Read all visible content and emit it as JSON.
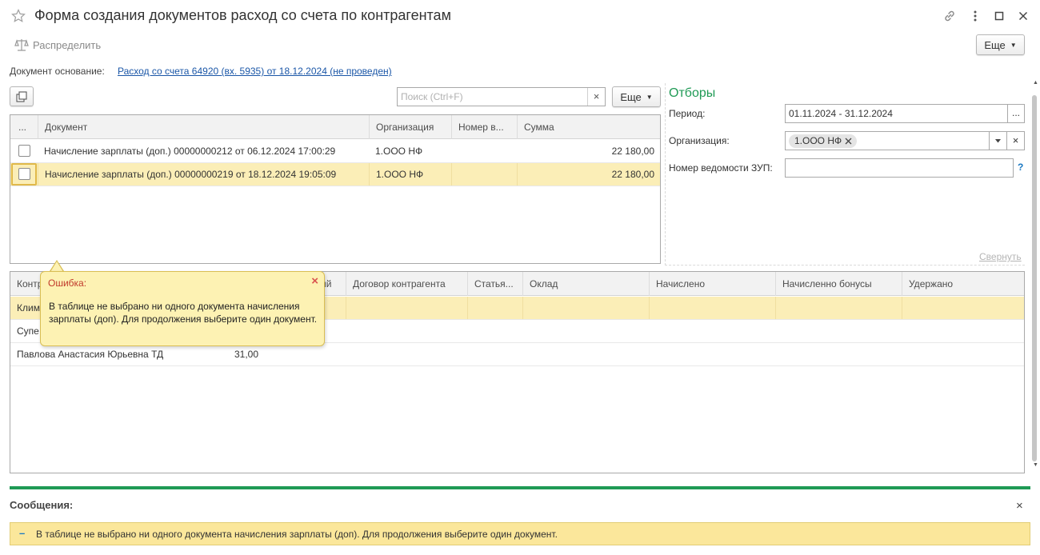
{
  "window": {
    "title": "Форма создания документов расход со счета по контрагентам"
  },
  "toolbar": {
    "distribute_label": "Распределить",
    "more_label": "Еще"
  },
  "basis": {
    "label": "Документ основание:",
    "link": "Расход со счета 64920 (вх. 5935) от 18.12.2024 (не проведен)"
  },
  "docs_panel": {
    "search_placeholder": "Поиск (Ctrl+F)",
    "search_clear": "×",
    "more_label": "Еще",
    "columns": [
      "...",
      "Документ",
      "Организация",
      "Номер в...",
      "Сумма"
    ],
    "rows": [
      {
        "checked": false,
        "document": "Начисление зарплаты (доп.) 00000000212 от 06.12.2024 17:00:29",
        "org": "1.ООО НФ",
        "number": "",
        "sum": "22 180,00"
      },
      {
        "checked": false,
        "document": "Начисление зарплаты (доп.) 00000000219 от 18.12.2024 19:05:09",
        "org": "1.ООО НФ",
        "number": "",
        "sum": "22 180,00"
      }
    ]
  },
  "filters": {
    "title": "Отборы",
    "period_label": "Период:",
    "period_value": "01.11.2024 - 31.12.2024",
    "period_btn": "...",
    "org_label": "Организация:",
    "org_tag": "1.ООО НФ",
    "org_clear": "×",
    "zup_label": "Номер ведомости ЗУП:",
    "zup_value": "",
    "help": "?",
    "collapse_link": "Свернуть"
  },
  "bottom_table": {
    "columns": [
      "Контр",
      "ий",
      "Договор контрагента",
      "Статья...",
      "Оклад",
      "Начислено",
      "Начисленно бонусы",
      "Удержано"
    ],
    "rows": [
      {
        "name": "Клим",
        "amount": ""
      },
      {
        "name": "Супе",
        "amount": ""
      },
      {
        "name": "Павлова Анастасия Юрьевна ТД",
        "amount": "31,00"
      }
    ]
  },
  "tooltip": {
    "title": "Ошибка:",
    "close": "×",
    "text": "В таблице не выбрано ни одного документа начисления зарплаты (доп). Для продолжения выберите один документ."
  },
  "messages": {
    "title": "Сообщения:",
    "close": "×",
    "bullet": "–",
    "text": "В таблице не выбрано ни одного документа начисления зарплаты (доп). Для продолжения выберите один документ."
  },
  "colors": {
    "accent_green": "#1f9a55",
    "selected_row": "#fbeeb7",
    "tooltip_bg": "#fdf2b3",
    "message_bg": "#fbe79b",
    "error_title": "#c0392b"
  }
}
